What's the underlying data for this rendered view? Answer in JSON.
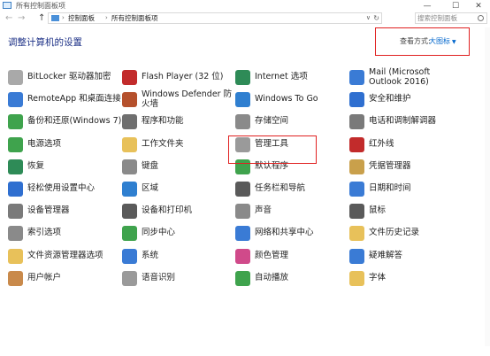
{
  "window": {
    "title": "所有控制面板项",
    "minimize": "—",
    "maximize": "☐",
    "close": "✕"
  },
  "address": {
    "back": "←",
    "forward": "→",
    "up": "↑",
    "crumbs": [
      "控制面板",
      "所有控制面板项"
    ],
    "sep": "›",
    "dropdown": "∨",
    "refresh": "↻"
  },
  "search": {
    "placeholder": "搜索控制面板"
  },
  "main": {
    "heading": "调整计算机的设置",
    "view_by_label": "查看方式:",
    "view_by_value": "大图标",
    "caret": "▼"
  },
  "items": {
    "col0": [
      {
        "label": "BitLocker 驱动器加密",
        "icon": "bitlocker-icon",
        "color": "#a9a9a9"
      },
      {
        "label": "RemoteApp 和桌面连接",
        "icon": "remoteapp-icon",
        "color": "#3a7bd5"
      },
      {
        "label": "备份和还原(Windows 7)",
        "icon": "backup-icon",
        "color": "#3fa34d"
      },
      {
        "label": "电源选项",
        "icon": "power-icon",
        "color": "#3fa34d"
      },
      {
        "label": "恢复",
        "icon": "recovery-icon",
        "color": "#2e8b57"
      },
      {
        "label": "轻松使用设置中心",
        "icon": "ease-of-access-icon",
        "color": "#2f6fd0"
      },
      {
        "label": "设备管理器",
        "icon": "device-manager-icon",
        "color": "#7a7a7a"
      },
      {
        "label": "索引选项",
        "icon": "indexing-icon",
        "color": "#8a8a8a"
      },
      {
        "label": "文件资源管理器选项",
        "icon": "folder-options-icon",
        "color": "#e8c15a"
      },
      {
        "label": "用户帐户",
        "icon": "user-accounts-icon",
        "color": "#c98a4b"
      }
    ],
    "col1": [
      {
        "label": "Flash Player (32 位)",
        "icon": "flash-icon",
        "color": "#c22b2b"
      },
      {
        "label": "Windows Defender 防火墙",
        "icon": "firewall-icon",
        "color": "#b5502c"
      },
      {
        "label": "程序和功能",
        "icon": "programs-icon",
        "color": "#6f6f6f"
      },
      {
        "label": "工作文件夹",
        "icon": "work-folders-icon",
        "color": "#e8c15a"
      },
      {
        "label": "键盘",
        "icon": "keyboard-icon",
        "color": "#8a8a8a"
      },
      {
        "label": "区域",
        "icon": "region-icon",
        "color": "#2f7fd0"
      },
      {
        "label": "设备和打印机",
        "icon": "printer-icon",
        "color": "#5a5a5a"
      },
      {
        "label": "同步中心",
        "icon": "sync-icon",
        "color": "#3fa34d"
      },
      {
        "label": "系统",
        "icon": "system-icon",
        "color": "#3a7bd5"
      },
      {
        "label": "语音识别",
        "icon": "microphone-icon",
        "color": "#9a9a9a"
      }
    ],
    "col2": [
      {
        "label": "Internet 选项",
        "icon": "internet-options-icon",
        "color": "#2e8b57"
      },
      {
        "label": "Windows To Go",
        "icon": "windows-to-go-icon",
        "color": "#2f7fd0"
      },
      {
        "label": "存储空间",
        "icon": "storage-icon",
        "color": "#8a8a8a"
      },
      {
        "label": "管理工具",
        "icon": "admin-tools-icon",
        "color": "#9a9a9a"
      },
      {
        "label": "默认程序",
        "icon": "default-programs-icon",
        "color": "#3fa34d"
      },
      {
        "label": "任务栏和导航",
        "icon": "taskbar-icon",
        "color": "#5a5a5a"
      },
      {
        "label": "声音",
        "icon": "sound-icon",
        "color": "#8a8a8a"
      },
      {
        "label": "网络和共享中心",
        "icon": "network-icon",
        "color": "#3a7bd5"
      },
      {
        "label": "颜色管理",
        "icon": "color-management-icon",
        "color": "#d04a8a"
      },
      {
        "label": "自动播放",
        "icon": "autoplay-icon",
        "color": "#3fa34d"
      }
    ],
    "col3": [
      {
        "label": "Mail (Microsoft Outlook 2016)",
        "icon": "mail-icon",
        "color": "#3a7bd5"
      },
      {
        "label": "安全和维护",
        "icon": "security-icon",
        "color": "#2f6fd0"
      },
      {
        "label": "电话和调制解调器",
        "icon": "phone-modem-icon",
        "color": "#7a7a7a"
      },
      {
        "label": "红外线",
        "icon": "infrared-icon",
        "color": "#c22b2b"
      },
      {
        "label": "凭据管理器",
        "icon": "credential-icon",
        "color": "#c9a04b"
      },
      {
        "label": "日期和时间",
        "icon": "date-time-icon",
        "color": "#3a7bd5"
      },
      {
        "label": "鼠标",
        "icon": "mouse-icon",
        "color": "#5a5a5a"
      },
      {
        "label": "文件历史记录",
        "icon": "file-history-icon",
        "color": "#e8c15a"
      },
      {
        "label": "疑难解答",
        "icon": "troubleshoot-icon",
        "color": "#3a7bd5"
      },
      {
        "label": "字体",
        "icon": "fonts-icon",
        "color": "#e8c15a"
      }
    ]
  }
}
